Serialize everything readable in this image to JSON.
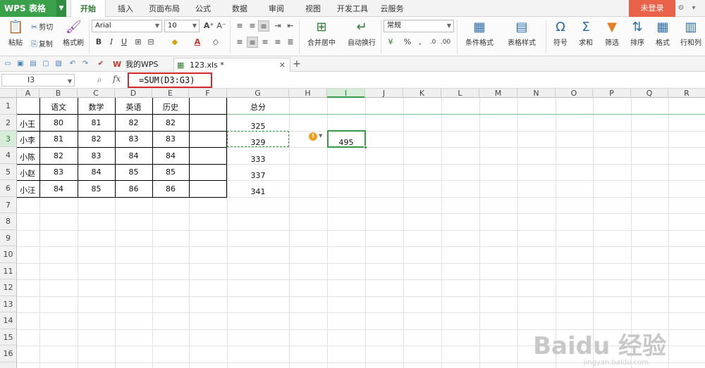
{
  "app": {
    "name": "WPS 表格",
    "login": "未登录"
  },
  "menu_tabs": [
    "开始",
    "插入",
    "页面布局",
    "公式",
    "数据",
    "审阅",
    "视图",
    "开发工具",
    "云服务"
  ],
  "ribbon": {
    "paste": "粘贴",
    "cut": "剪切",
    "copy": "复制",
    "format_painter": "格式刷",
    "font_name": "Arial",
    "font_size": "10",
    "merge_center": "合并居中",
    "wrap_text": "自动换行",
    "number_format": "常规",
    "cond_format": "条件格式",
    "table_style": "表格样式",
    "symbol": "符号",
    "sum": "求和",
    "filter": "筛选",
    "sort": "排序",
    "format": "格式",
    "row_col": "行和列"
  },
  "doc_tabs": [
    {
      "label": "我的WPS"
    },
    {
      "label": "123.xls *"
    }
  ],
  "formula_bar": {
    "cell_ref": "I3",
    "formula": "=SUM(D3:G3)"
  },
  "columns": [
    "A",
    "B",
    "C",
    "D",
    "E",
    "F",
    "G",
    "H",
    "I",
    "J",
    "K",
    "L",
    "M",
    "N",
    "O",
    "P",
    "Q",
    "R"
  ],
  "rows": [
    "1",
    "2",
    "3",
    "4",
    "5",
    "6",
    "7",
    "8",
    "9",
    "10",
    "11",
    "12",
    "13",
    "14",
    "15",
    "16"
  ],
  "table": {
    "headers": [
      "语文",
      "数学",
      "英语",
      "历史"
    ],
    "names": [
      "小王",
      "小李",
      "小陈",
      "小赵",
      "小汪"
    ],
    "values": [
      [
        "80",
        "81",
        "82",
        "82"
      ],
      [
        "81",
        "82",
        "83",
        "83"
      ],
      [
        "82",
        "83",
        "84",
        "84"
      ],
      [
        "83",
        "84",
        "85",
        "85"
      ],
      [
        "84",
        "85",
        "86",
        "86"
      ]
    ]
  },
  "total": {
    "header": "总分",
    "values": [
      "325",
      "329",
      "333",
      "337",
      "341"
    ]
  },
  "active_cell_value": "495",
  "watermark": {
    "logo": "Baidu 经验",
    "url": "jingyan.baidu.com"
  }
}
